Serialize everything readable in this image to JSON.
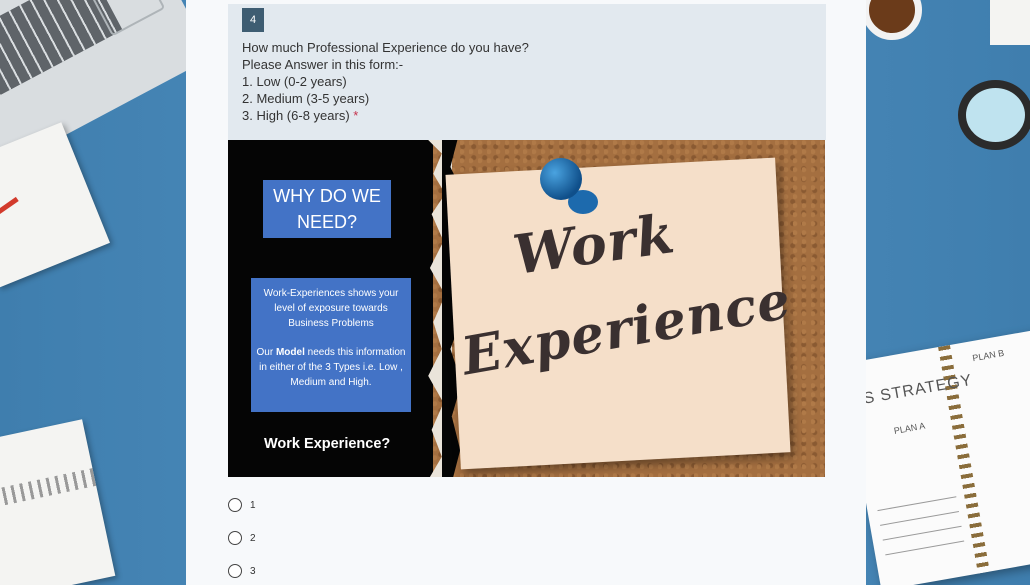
{
  "question": {
    "number": "4",
    "lines": [
      "How much Professional Experience do you have?",
      "Please Answer in this form:-",
      "1. Low (0-2 years)",
      "2. Medium (3-5 years)",
      "3. High (6-8 years)"
    ],
    "required_marker": "*"
  },
  "image": {
    "why_box_line1": "WHY DO WE",
    "why_box_line2": "NEED?",
    "info_para1": "Work-Experiences shows your level of exposure towards Business Problems",
    "info_para2_pre": "Our ",
    "info_para2_bold": "Model",
    "info_para2_post": " needs this information in either of the 3 Types i.e. Low , Medium and High.",
    "caption": "Work Experience?",
    "note_word1": "Work",
    "note_word2": "Experience"
  },
  "options": [
    {
      "label": "1"
    },
    {
      "label": "2"
    },
    {
      "label": "3"
    }
  ],
  "background": {
    "book_title": "SS STRATEGY",
    "plan_a": "PLAN A",
    "plan_b": "PLAN B"
  },
  "colors": {
    "accent": "#3e5d72",
    "header_bg": "#e2e9ef",
    "required": "#c4314b",
    "info_box": "#4373c6"
  }
}
